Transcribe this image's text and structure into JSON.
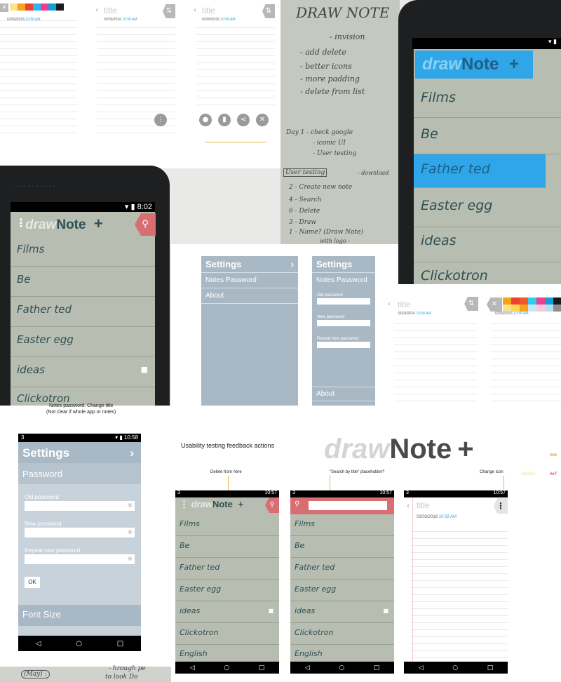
{
  "note_screens": {
    "date": "02/03/2016",
    "time": "10:58 AM",
    "title_placeholder": "title",
    "back_icon": "chevron-left-icon",
    "change_icon": "swap-icon",
    "close_icon": "x-icon",
    "more_icon": "vertical-dots-icon",
    "action_icons": [
      "lock-icon",
      "trash-icon",
      "share-icon",
      "close-icon"
    ]
  },
  "palette": {
    "colors": [
      "#f7a21b",
      "#ea4335",
      "#2fb4f0",
      "#ee3f8f",
      "#1a1a1a",
      "#f9e48b",
      "#33c9f2",
      "#f05a28",
      "#0ea0d8",
      "#fbd84e"
    ]
  },
  "handwritten_notes": {
    "heading": "DRAW NOTE",
    "lines": [
      "- invision",
      "- add delete",
      "- better icons",
      "- more padding",
      "- delete from list",
      "Day 1 - check google",
      "- iconic UI",
      "- User testing",
      "User testing",
      "- download",
      "2 - Create new note",
      "4 - Search",
      "6 - Delete",
      "3 - Draw",
      "1 - Name? (Draw Note)",
      "with logo -"
    ],
    "bottom_fragments": [
      "(May) :",
      "- hrough pe",
      "to look Do"
    ]
  },
  "app": {
    "brand_left": "draw",
    "brand_right": "Note",
    "add_icon": "plus-icon",
    "search_icon": "search-icon",
    "menu_icon": "vertical-dots-icon",
    "lock_icon": "lock-icon",
    "notes": [
      "Films",
      "Be",
      "Father ted",
      "Easter egg",
      "ideas",
      "Clickotron",
      "English"
    ],
    "status_time_a": "8:02",
    "status_time_b": "10:58",
    "status_time_c": "10:57",
    "status_carrier": "3"
  },
  "settings_panel": {
    "title": "Settings",
    "notes_password": "Notes Password",
    "about": "About",
    "old_password": "Old password",
    "new_password": "New password",
    "repeat_password": "Repeat new password",
    "ok": "OK",
    "password_header": "Password",
    "font_size": "Font Size",
    "chevron": "›"
  },
  "annotations": {
    "settings_note_line1": "Notes password. Change title",
    "settings_note_line2": "(Not clear if whole app or notes)",
    "usability_title": "Usability testing feedback actions",
    "delete_from_here": "Delete from here",
    "search_placeholder_note": "\"Search by title\" placeholder?",
    "change_icon_note": "Change icon"
  },
  "logo": {
    "left": "draw",
    "right": "Note",
    "plus": "+"
  },
  "hex_codes": [
    "#e6",
    "#fbdb82",
    "#e7"
  ],
  "accent": {
    "red": "#d96e72",
    "blue_highlight": "#2ea6e8",
    "settings_blue": "#a9b8c5",
    "list_green": "#b7bdb0"
  }
}
